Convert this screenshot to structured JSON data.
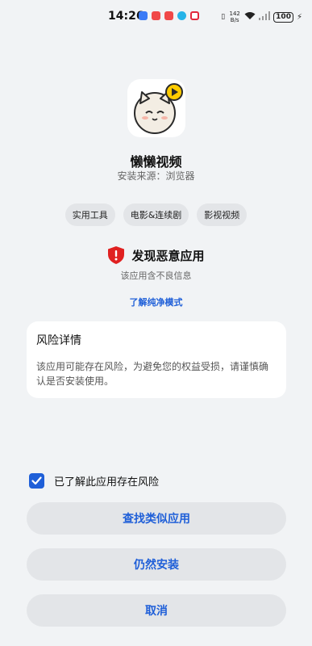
{
  "status_bar": {
    "time": "14:26",
    "net_speed": "142 B/s",
    "battery": "100",
    "notification_colors": [
      "#3b7bf6",
      "#f04848",
      "#f04848",
      "#26b3e8",
      "#e2283c"
    ]
  },
  "app": {
    "name": "懒懒视频",
    "source_label": "安装来源：",
    "source_value": "浏览器",
    "icon": "cat-play-icon"
  },
  "tags": [
    "实用工具",
    "电影&连续剧",
    "影视视频"
  ],
  "warning": {
    "title": "发现恶意应用",
    "subtitle": "该应用含不良信息",
    "link": "了解纯净模式",
    "icon": "shield-alert-icon",
    "icon_color": "#e02020"
  },
  "risk_card": {
    "title": "风险详情",
    "body": "该应用可能存在风险，为避免您的权益受损，请谨慎确认是否安装使用。"
  },
  "acknowledge": {
    "label": "已了解此应用存在风险",
    "checked": true
  },
  "buttons": {
    "find_similar": "查找类似应用",
    "install_anyway": "仍然安装",
    "cancel": "取消"
  },
  "accent_color": "#1f5fd8"
}
